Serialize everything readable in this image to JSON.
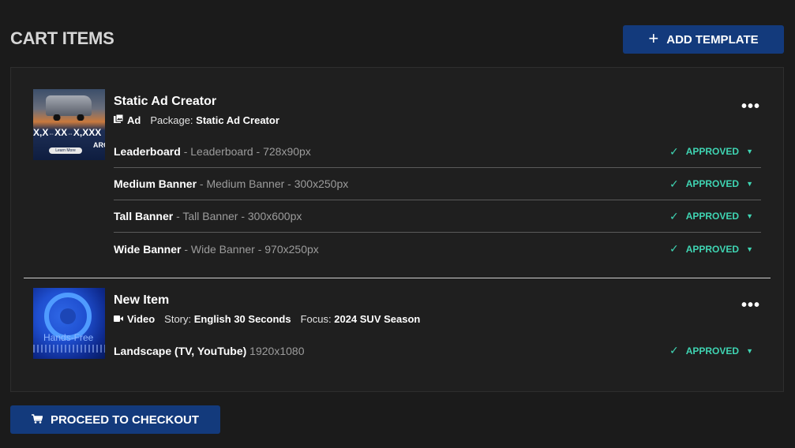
{
  "header": {
    "title": "CART ITEMS",
    "add_template_label": "ADD TEMPLATE"
  },
  "items": [
    {
      "title": "Static Ad Creator",
      "type_label": "Ad",
      "package_label": "Package:",
      "package_value": "Static Ad Creator",
      "thumbnail": {
        "price_text": "X,X",
        "price_text2": "XX",
        "price_text3": "X,XXX",
        "cta": "Learn More",
        "brand_text": "ARC"
      },
      "rows": [
        {
          "name": "Leaderboard",
          "detail": " - Leaderboard - 728x90px",
          "status": "APPROVED"
        },
        {
          "name": "Medium Banner",
          "detail": " - Medium Banner - 300x250px",
          "status": "APPROVED"
        },
        {
          "name": "Tall Banner",
          "detail": " - Tall Banner - 300x600px",
          "status": "APPROVED"
        },
        {
          "name": "Wide Banner",
          "detail": " - Wide Banner - 970x250px",
          "status": "APPROVED"
        }
      ]
    },
    {
      "title": "New Item",
      "type_label": "Video",
      "story_label": "Story:",
      "story_value": "English 30 Seconds",
      "focus_label": "Focus:",
      "focus_value": "2024 SUV Season",
      "thumbnail": {
        "overlay_text": "Hands-Free"
      },
      "rows": [
        {
          "name": "Landscape (TV, YouTube)",
          "detail": " 1920x1080",
          "status": "APPROVED"
        }
      ]
    }
  ],
  "footer": {
    "checkout_label": "PROCEED TO CHECKOUT"
  },
  "colors": {
    "accent_blue": "#133a7c",
    "approved": "#3fd5b3",
    "background": "#1b1b1b"
  },
  "icons": [
    "plus-icon",
    "image-icon",
    "video-icon",
    "more-icon",
    "check-icon",
    "chevron-down-icon",
    "cart-icon"
  ]
}
